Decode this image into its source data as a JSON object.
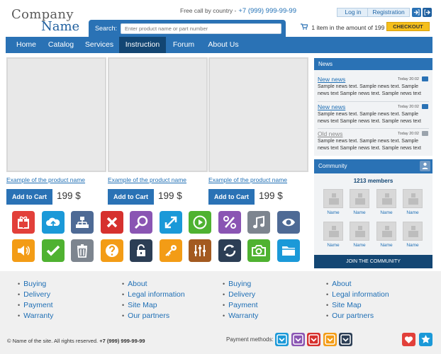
{
  "logo": {
    "line1": "Company",
    "line2": "Name"
  },
  "header": {
    "phone_label": "Free call by country -",
    "phone_number": "+7 (999) 999-99-99",
    "login": "Log in",
    "registration": "Registration",
    "icon1": "login-icon",
    "icon2": "exit-icon"
  },
  "search": {
    "label": "Search:",
    "placeholder": "Enter product name or part number"
  },
  "cart": {
    "text": "1 item in the amount of 199 $",
    "checkout": "CHECKOUT"
  },
  "nav": {
    "items": [
      {
        "label": "Home",
        "active": false
      },
      {
        "label": "Catalog",
        "active": false
      },
      {
        "label": "Services",
        "active": false
      },
      {
        "label": "Instruction",
        "active": true
      },
      {
        "label": "Forum",
        "active": false
      },
      {
        "label": "About Us",
        "active": false
      }
    ]
  },
  "products": [
    {
      "name": "Example of the product name",
      "button": "Add to Cart",
      "price": "199 $"
    },
    {
      "name": "Example of the product name",
      "button": "Add to Cart",
      "price": "199 $"
    },
    {
      "name": "Example of the product name",
      "button": "Add to Cart",
      "price": "199 $"
    }
  ],
  "icons": [
    {
      "name": "gift-icon",
      "color": "#e2403a"
    },
    {
      "name": "cloud-upload-icon",
      "color": "#1b99d8"
    },
    {
      "name": "sitemap-icon",
      "color": "#4e6a95"
    },
    {
      "name": "close-icon",
      "color": "#d6312e"
    },
    {
      "name": "search-icon",
      "color": "#8a55b3"
    },
    {
      "name": "expand-icon",
      "color": "#1b99d8"
    },
    {
      "name": "play-icon",
      "color": "#4fb231"
    },
    {
      "name": "percent-icon",
      "color": "#8a55b3"
    },
    {
      "name": "music-icon",
      "color": "#7d858f"
    },
    {
      "name": "eye-icon",
      "color": "#4e6a95"
    },
    {
      "name": "volume-icon",
      "color": "#f39c16"
    },
    {
      "name": "check-icon",
      "color": "#4fb231"
    },
    {
      "name": "trash-icon",
      "color": "#7d858f"
    },
    {
      "name": "help-icon",
      "color": "#f39c16"
    },
    {
      "name": "lock-icon",
      "color": "#2c3e55"
    },
    {
      "name": "key-icon",
      "color": "#f39c16"
    },
    {
      "name": "equalizer-icon",
      "color": "#a35a20"
    },
    {
      "name": "recycle-icon",
      "color": "#2c3e55"
    },
    {
      "name": "camera-icon",
      "color": "#4fb231"
    },
    {
      "name": "folder-icon",
      "color": "#1b99d8"
    }
  ],
  "news": {
    "title": "News",
    "items": [
      {
        "title": "New news",
        "date": "Today 20:02",
        "text": "Sample news text. Sample news text. Sample news text Sample news text. Sample news text",
        "dim": false
      },
      {
        "title": "New news",
        "date": "Today 20:02",
        "text": "Sample news text. Sample news text. Sample news text Sample news text. Sample news text",
        "dim": false
      },
      {
        "title": "Old news",
        "date": "Today 20:02",
        "text": "Sample news text. Sample news text. Sample news text Sample news text. Sample news text",
        "dim": true
      }
    ]
  },
  "community": {
    "title": "Community",
    "members": "1213 members",
    "member_names": [
      "Name",
      "Name",
      "Name",
      "Name",
      "Name",
      "Name",
      "Name",
      "Name"
    ],
    "join": "JOIN THE COMMUNITY"
  },
  "footer": {
    "columns": [
      [
        "Buying",
        "Delivery",
        "Payment",
        "Warranty"
      ],
      [
        "About",
        "Legal information",
        "Site Map",
        "Our partners"
      ],
      [
        "Buying",
        "Delivery",
        "Payment",
        "Warranty"
      ],
      [
        "About",
        "Legal information",
        "Site Map",
        "Our partners"
      ]
    ],
    "copyright": "© Name of the site. All rights reserved.",
    "copyright_phone": "+7 (999) 999-99-99",
    "payment_label": "Payment methods:",
    "payment_colors": [
      "#1b99d8",
      "#8a55b3",
      "#d6312e",
      "#f39c16",
      "#2c3e55"
    ],
    "social": [
      {
        "name": "heart-icon",
        "color": "#e2403a"
      },
      {
        "name": "star-icon",
        "color": "#1b99d8"
      }
    ]
  }
}
